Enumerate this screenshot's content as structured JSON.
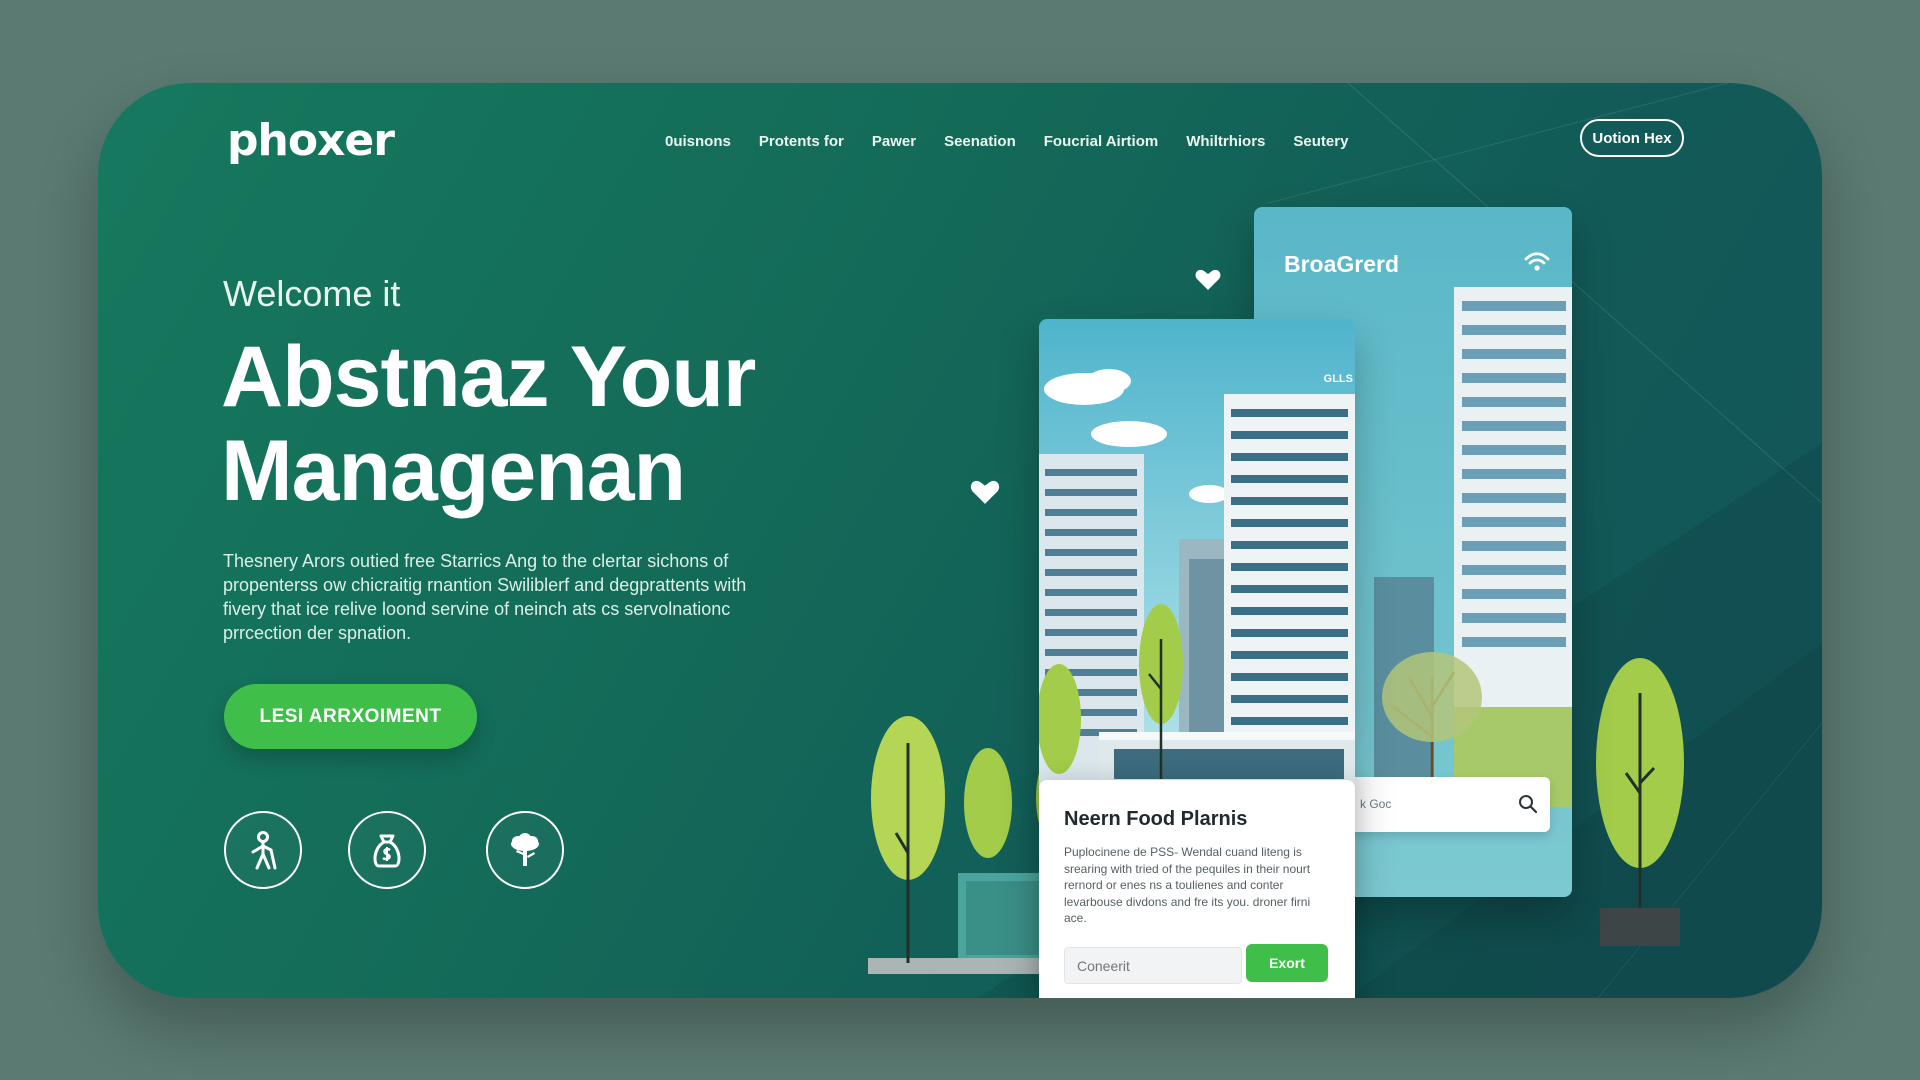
{
  "brand": {
    "logo": "phoxer"
  },
  "nav": {
    "items": [
      "0uisnons",
      "Protents for",
      "Pawer",
      "Seenation",
      "Foucrial Airtiom",
      "Whiltrhiors",
      "Seutery"
    ]
  },
  "top_button": {
    "label": "Uotion Hex"
  },
  "hero": {
    "welcome": "Welcome it",
    "headline_line1": "Abstnaz Your",
    "headline_line2": "Managenan",
    "description": "Thesnery Arors outied free Starrics Ang to the clertar sichons of propenterss ow chicraitig rnantion Swiliblerf and degprattents with fivery that ice relive loond servine of neinch ats cs servolnationc prrcection der spnation.",
    "cta_label": "LESI ARRXOIMENT"
  },
  "feature_icons": [
    "person-cane-icon",
    "money-bag-icon",
    "tree-icon"
  ],
  "back_card": {
    "title": "BroaGrerd",
    "search_placeholder": "k Goc"
  },
  "front_card": {
    "tag": "GLLS"
  },
  "food_card": {
    "title": "Neern Food Plarnis",
    "text": "Puplocinene de PSS- Wendal cuand liteng is srearing with tried of the pequiles in their nourt rernord or enes ns a toulienes and conter levarbouse divdons and fre its you. droner firni ace.",
    "input_placeholder": "Coneerit",
    "button_label": "Exort"
  },
  "colors": {
    "accent": "#3fbf4a",
    "hero_bg": "#16735c",
    "page_bg": "#5a7a72"
  }
}
